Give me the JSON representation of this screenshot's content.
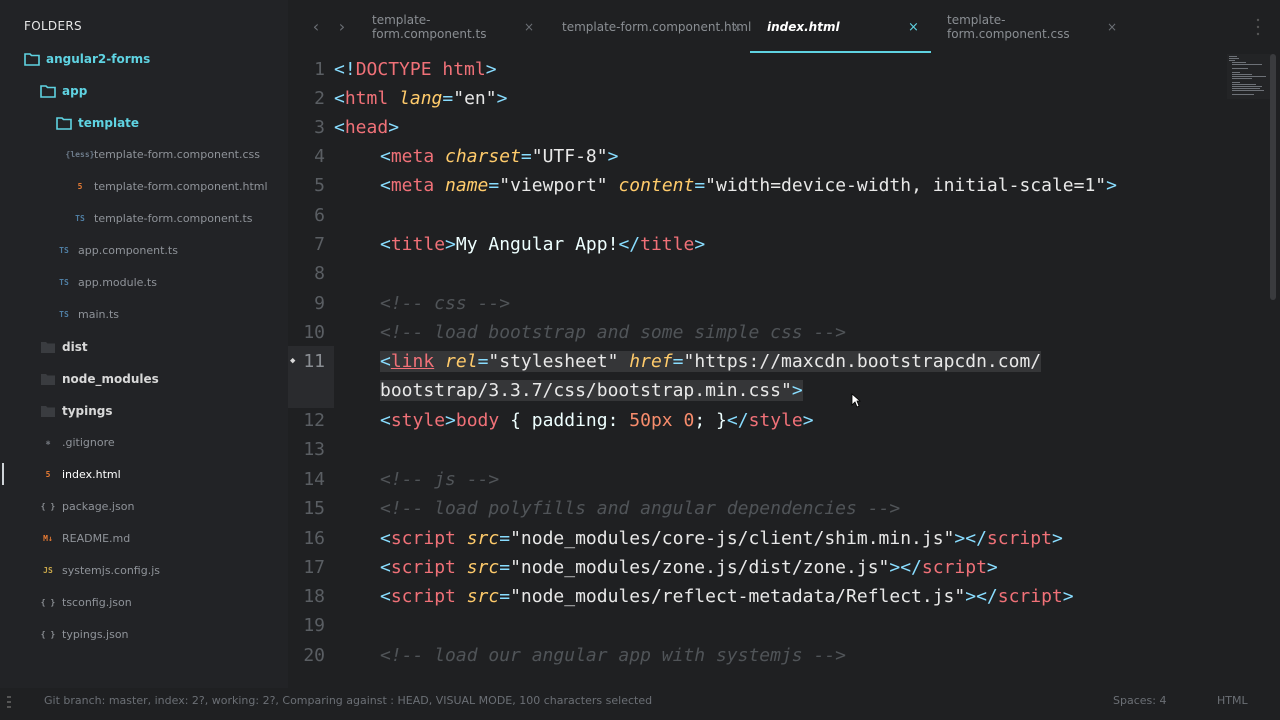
{
  "sidebar": {
    "header": "FOLDERS",
    "tree": [
      {
        "label": "angular2-forms",
        "kind": "folder-open",
        "icon": "folder-open-icon"
      },
      {
        "label": "app",
        "kind": "folder-open",
        "icon": "folder-open-icon"
      },
      {
        "label": "template",
        "kind": "folder-open",
        "icon": "folder-open-icon"
      },
      {
        "label": "template-form.component.css",
        "kind": "file",
        "icon": "less-file-icon",
        "icon_text": "{less}"
      },
      {
        "label": "template-form.component.html",
        "kind": "file",
        "icon": "html5-file-icon",
        "icon_text": "5"
      },
      {
        "label": "template-form.component.ts",
        "kind": "file",
        "icon": "typescript-file-icon",
        "icon_text": "TS"
      },
      {
        "label": "app.component.ts",
        "kind": "file",
        "icon": "typescript-file-icon",
        "icon_text": "TS"
      },
      {
        "label": "app.module.ts",
        "kind": "file",
        "icon": "typescript-file-icon",
        "icon_text": "TS"
      },
      {
        "label": "main.ts",
        "kind": "file",
        "icon": "typescript-file-icon",
        "icon_text": "TS"
      },
      {
        "label": "dist",
        "kind": "folder",
        "icon": "folder-closed-icon"
      },
      {
        "label": "node_modules",
        "kind": "folder",
        "icon": "folder-closed-icon"
      },
      {
        "label": "typings",
        "kind": "folder",
        "icon": "folder-closed-icon"
      },
      {
        "label": ".gitignore",
        "kind": "file",
        "icon": "asterisk-file-icon",
        "icon_text": "✱"
      },
      {
        "label": "index.html",
        "kind": "file",
        "icon": "html5-file-icon",
        "icon_text": "5",
        "active": true
      },
      {
        "label": "package.json",
        "kind": "file",
        "icon": "json-file-icon",
        "icon_text": "{ }"
      },
      {
        "label": "README.md",
        "kind": "file",
        "icon": "markdown-file-icon",
        "icon_text": "M↓"
      },
      {
        "label": "systemjs.config.js",
        "kind": "file",
        "icon": "javascript-file-icon",
        "icon_text": "JS"
      },
      {
        "label": "tsconfig.json",
        "kind": "file",
        "icon": "json-file-icon",
        "icon_text": "{ }"
      },
      {
        "label": "typings.json",
        "kind": "file",
        "icon": "json-file-icon",
        "icon_text": "{ }"
      }
    ]
  },
  "tabs": [
    {
      "label": "template-form.component.ts",
      "close": "×"
    },
    {
      "label": "template-form.component.html",
      "close": "×"
    },
    {
      "label": "index.html",
      "close": "×",
      "active": true
    },
    {
      "label": "template-form.component.css",
      "close": "×"
    }
  ],
  "nav": {
    "back": "‹",
    "forward": "›"
  },
  "editor": {
    "line_numbers": [
      "1",
      "2",
      "3",
      "4",
      "5",
      "6",
      "7",
      "8",
      "9",
      "10",
      "11",
      "12",
      "13",
      "14",
      "15",
      "16",
      "17",
      "18",
      "19",
      "20"
    ],
    "current_line": "11",
    "code": {
      "l1": {
        "open": "<!",
        "tag": "DOCTYPE html",
        "close": ">"
      },
      "l2": {
        "open": "<",
        "tag": "html",
        "attr": "lang",
        "eq": "=",
        "val": "\"en\"",
        "close": ">"
      },
      "l3": {
        "open": "<",
        "tag": "head",
        "close": ">"
      },
      "l4": {
        "open": "<",
        "tag": "meta",
        "attr": "charset",
        "eq": "=",
        "val": "\"UTF-8\"",
        "close": ">"
      },
      "l5": {
        "open": "<",
        "tag": "meta",
        "attr1": "name",
        "eq1": "=",
        "val1": "\"viewport\"",
        "attr2": "content",
        "eq2": "=",
        "val2": "\"width=device-width, initial-scale=1\"",
        "close": ">"
      },
      "l7": {
        "open": "<",
        "tag": "title",
        "mid1": ">",
        "text": "My Angular App!",
        "open2": "</",
        "tag2": "title",
        "close": ">"
      },
      "l9": "<!-- css -->",
      "l10": "<!-- load bootstrap and some simple css -->",
      "l11a": {
        "open": "<",
        "tag": "link",
        "attr1": "rel",
        "eq1": "=",
        "val1": "\"stylesheet\"",
        "attr2": "href",
        "eq2": "=",
        "val2": "\"https://maxcdn.bootstrapcdn.com/"
      },
      "l11b": {
        "val": "bootstrap/3.3.7/css/bootstrap.min.css\"",
        "close": ">"
      },
      "l12": {
        "open": "<",
        "tag": "style",
        "mid": ">",
        "sel": "body",
        "brace1": " { ",
        "prop": "padding",
        "colon": ": ",
        "num1": "50px",
        "sp": " ",
        "num2": "0",
        "semi": "; ",
        "brace2": "}",
        "open2": "</",
        "tag2": "style",
        "close": ">"
      },
      "l14": "<!-- js -->",
      "l15": "<!-- load polyfills and angular dependencies -->",
      "l16": {
        "open": "<",
        "tag": "script",
        "attr": "src",
        "eq": "=",
        "val": "\"node_modules/core-js/client/shim.min.js\"",
        "mid": "></",
        "tag2": "script",
        "close": ">"
      },
      "l17": {
        "open": "<",
        "tag": "script",
        "attr": "src",
        "eq": "=",
        "val": "\"node_modules/zone.js/dist/zone.js\"",
        "mid": "></",
        "tag2": "script",
        "close": ">"
      },
      "l18": {
        "open": "<",
        "tag": "script",
        "attr": "src",
        "eq": "=",
        "val": "\"node_modules/reflect-metadata/Reflect.js\"",
        "mid": "></",
        "tag2": "script",
        "close": ">"
      },
      "l20": "<!-- load our angular app with systemjs -->"
    }
  },
  "status": {
    "left": "Git branch: master, index: 2?, working: 2?, Comparing against : HEAD, VISUAL MODE, 100 characters selected",
    "spaces": "Spaces: 4",
    "syntax": "HTML"
  },
  "colors": {
    "accent": "#5fd3e2",
    "tag": "#f07178",
    "attribute": "#ffcb6b",
    "string": "#c3e88d",
    "comment": "#505458",
    "number": "#f78c6c",
    "background": "#1f2022"
  }
}
